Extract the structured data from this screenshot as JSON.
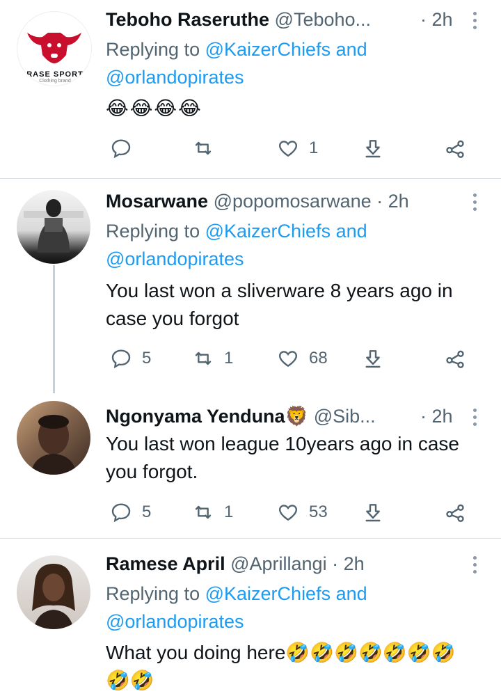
{
  "tweets": [
    {
      "name": "Teboho Raseruthe",
      "handle": "@Teboho...",
      "time": "· 2h",
      "replying_prefix": "Replying to",
      "mention1": "@KaizerChiefs",
      "and": "and",
      "mention2": "@orlandopirates",
      "body": "😂😂😂😂",
      "avatar_text_top": "RASE SPORT",
      "avatar_text_bottom": "Clothing brand",
      "counts": {
        "reply": "",
        "retweet": "",
        "like": "1"
      }
    },
    {
      "name": "Mosarwane",
      "handle": "@popomosarwane",
      "time": "· 2h",
      "replying_prefix": "Replying to",
      "mention1": "@KaizerChiefs",
      "and": "and",
      "mention2": "@orlandopirates",
      "body_line1": "You last won a sliverware 8 years ago in",
      "body_line2": "case you forgot",
      "counts": {
        "reply": "5",
        "retweet": "1",
        "like": "68"
      }
    },
    {
      "name": "Ngonyama Yenduna🦁",
      "handle": "@Sib...",
      "time": "· 2h",
      "body_line1": "You last won league 10years ago in case",
      "body_line2": "you forgot.",
      "counts": {
        "reply": "5",
        "retweet": "1",
        "like": "53"
      }
    },
    {
      "name": "Ramese April",
      "handle": "@Aprillangi",
      "time": "· 2h",
      "replying_prefix": "Replying to",
      "mention1": "@KaizerChiefs",
      "and": "and",
      "mention2": "@orlandopirates",
      "body_line1": "What you doing here🤣🤣🤣🤣🤣🤣🤣",
      "body_line2": "🤣🤣"
    }
  ],
  "colors": {
    "accent": "#1d9bf0",
    "secondary": "#536471",
    "divider": "#d9dee2"
  },
  "icons": [
    "reply-icon",
    "retweet-icon",
    "like-icon",
    "download-icon",
    "share-icon",
    "more-icon"
  ]
}
